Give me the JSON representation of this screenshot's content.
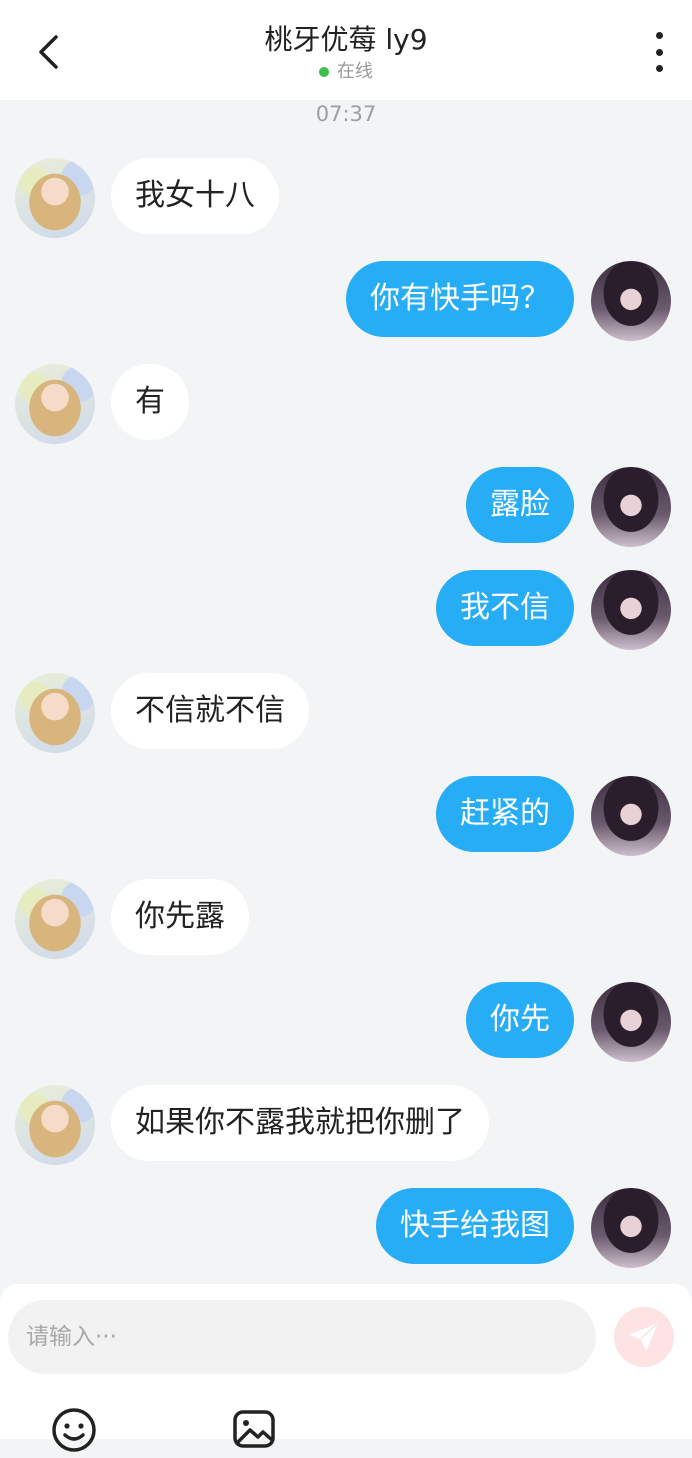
{
  "header": {
    "title": "桃牙优莓 ly9",
    "status": "在线",
    "status_color": "#3dbf4b"
  },
  "timestamp": "07:37",
  "messages": [
    {
      "side": "in",
      "text": "我女十八"
    },
    {
      "side": "out",
      "text": "你有快手吗？"
    },
    {
      "side": "in",
      "text": "有"
    },
    {
      "side": "out",
      "text": "露脸"
    },
    {
      "side": "out",
      "text": "我不信"
    },
    {
      "side": "in",
      "text": "不信就不信"
    },
    {
      "side": "out",
      "text": "赶紧的"
    },
    {
      "side": "in",
      "text": "你先露"
    },
    {
      "side": "out",
      "text": "你先"
    },
    {
      "side": "in",
      "text": "如果你不露我就把你删了"
    },
    {
      "side": "out",
      "text": "快手给我图"
    }
  ],
  "composer": {
    "placeholder": "请输入···",
    "send_icon": "send-icon",
    "tools": [
      "emoji-icon",
      "image-icon"
    ]
  },
  "colors": {
    "accent": "#27adf5",
    "background": "#f3f4f6"
  }
}
